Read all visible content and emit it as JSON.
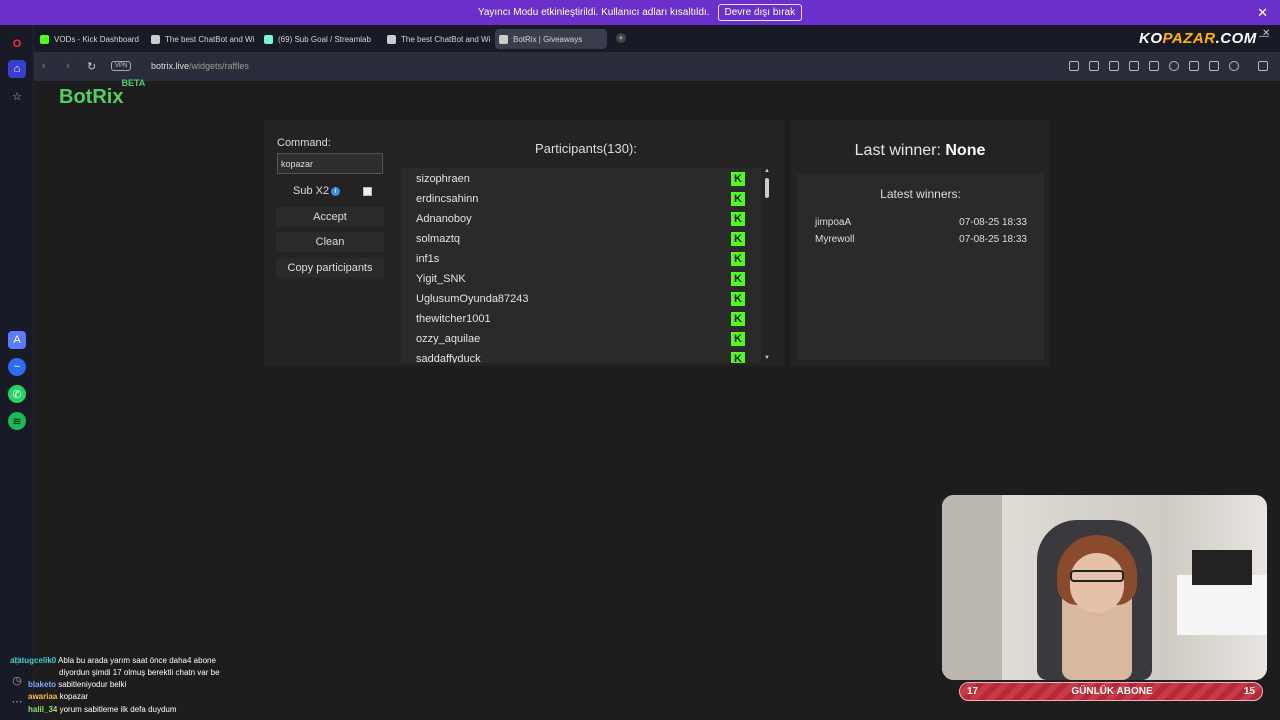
{
  "notification": {
    "text": "Yayıncı Modu etkinleştirildi. Kullanıcı adları kısaltıldı.",
    "button": "Devre dışı bırak",
    "close": "✕"
  },
  "tabs": [
    {
      "label": "VODs - Kick Dashboard",
      "color": "#53fc18"
    },
    {
      "label": "The best ChatBot and Wi",
      "color": "#cccccc"
    },
    {
      "label": "(69) Sub Goal / Streamlab",
      "color": "#80f5d2"
    },
    {
      "label": "The best ChatBot and Wi",
      "color": "#cccccc"
    },
    {
      "label": "BotRix | Giveaways",
      "color": "#cccccc"
    }
  ],
  "new_tab": "+",
  "overlay_logo": {
    "prefix": "KO",
    "highlight": "PAZAR",
    "suffix": ".COM"
  },
  "address": {
    "vpn": "VPN",
    "host": "botrix.live",
    "path": "/widgets/raffles"
  },
  "brand": {
    "name": "BotRix",
    "badge": "BETA"
  },
  "raffle": {
    "command_label": "Command:",
    "command_value": "kopazar",
    "sub_x2": "Sub X2",
    "info": "i",
    "accept": "Accept",
    "clean": "Clean",
    "copy": "Copy participants",
    "participants_title": "Participants(130):",
    "participants": [
      "sizophraen",
      "erdincsahinn",
      "Adnanoboy",
      "solmaztq",
      "inf1s",
      "Yigit_SNK",
      "UglusumOyunda87243",
      "thewitcher1001",
      "ozzy_aquilae",
      "saddaffyduck"
    ],
    "kick_icon": "K"
  },
  "winners": {
    "last_label": "Last winner:",
    "last_value": "None",
    "latest_title": "Latest winners:",
    "rows": [
      {
        "name": "jimpoaA",
        "date": "07-08-25 18:33"
      },
      {
        "name": "Myrewoll",
        "date": "07-08-25 18:33"
      }
    ]
  },
  "subgoal": {
    "left": "17",
    "label": "GÜNLÜK ABONE",
    "right": "15"
  },
  "chat": [
    {
      "user": "atatugcelik0",
      "color": "#3fd0c9",
      "msg": "Abla bu arada yarım saat önce daha4 abone"
    },
    {
      "user": "",
      "color": "#ffffff",
      "msg": "diyordun şimdi 17 olmuş berektli chatn var be"
    },
    {
      "user": "blaketo",
      "color": "#7fa6ff",
      "msg": "sabitleniyodur belki"
    },
    {
      "user": "awariaa",
      "color": "#ffb84d",
      "msg": "kopazar"
    },
    {
      "user": "halil_34",
      "color": "#8fe36a",
      "msg": "yorum sabitleme ilk defa duydum"
    }
  ]
}
